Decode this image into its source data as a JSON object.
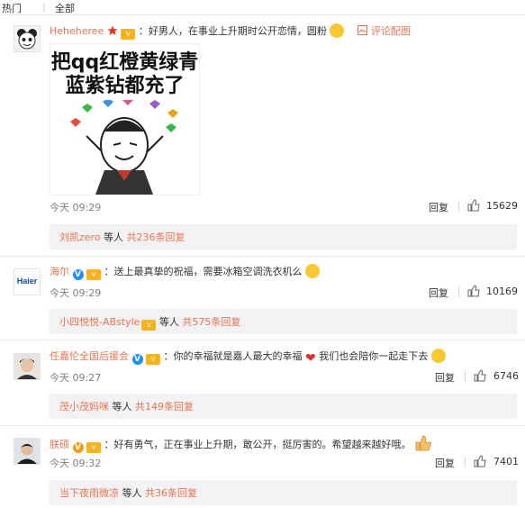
{
  "tabs": {
    "hot": "热门",
    "all": "全部"
  },
  "comments": [
    {
      "username": "Heheheree",
      "text": "：好男人，在事业上升期时公开恋情，圆粉",
      "pic_link": "评论配图",
      "meme_lines": [
        "把qq红橙黄绿青",
        "蓝紫钻都充了"
      ],
      "time": "今天 09:29",
      "reply": "回复",
      "likes": "15629",
      "sub": {
        "names": "刘凯zero",
        "mid": " 等人 ",
        "count": "共236条回复"
      }
    },
    {
      "username": "海尔",
      "avatar_text": "Haier",
      "text": "：送上最真挚的祝福，需要冰箱空调洗衣机么",
      "time": "今天 09:29",
      "reply": "回复",
      "likes": "10169",
      "sub": {
        "names": "小四悦悦-ABstyle",
        "mid": " 等人 ",
        "count": "共575条回复"
      }
    },
    {
      "username": "任嘉伦全国后援会",
      "text": "：你的幸福就是嘉人最大的幸福",
      "text2": "我们也会陪你一起走下去",
      "time": "今天 09:27",
      "reply": "回复",
      "likes": "6746",
      "sub": {
        "names": "茂小茂妈咪",
        "mid": " 等人 ",
        "count": "共149条回复"
      }
    },
    {
      "username": "朕硕",
      "text": "：好有勇气，正在事业上升期，敢公开，挺厉害的。希望越来越好哦。",
      "time": "今天 09:32",
      "reply": "回复",
      "likes": "7401",
      "sub": {
        "names": "当下夜雨微凉",
        "mid": " 等人 ",
        "count": "共36条回复"
      }
    }
  ],
  "colors": {
    "accent": "#eb7350",
    "vip": "#f7b21e",
    "verified_blue": "#1e90ff",
    "verified_orange": "#f79b15"
  }
}
